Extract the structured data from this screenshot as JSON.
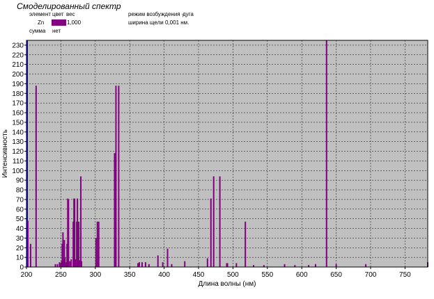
{
  "header": {
    "title": "Смоделированный спектр",
    "legend_header": {
      "element": "элемент",
      "color": "цвет",
      "weight": "вес"
    },
    "legend_row": {
      "element": "Zn",
      "weight": "1,000"
    },
    "sum": {
      "label": "сумма",
      "value": "нет"
    },
    "excitation": {
      "label": "режим возбуждения -",
      "value": "дуга"
    },
    "slit": {
      "label": "ширина щели",
      "value": "0,001 нм."
    }
  },
  "colors": {
    "plot_bg": "#c0c0c0",
    "series": "#800080",
    "left_line": "#0000ff"
  },
  "chart_data": {
    "type": "bar",
    "xlabel": "Длина волны (нм)",
    "ylabel": "Интенсивность",
    "xlim": [
      200,
      783
    ],
    "ylim": [
      0,
      235
    ],
    "xticks": [
      200,
      250,
      300,
      350,
      400,
      450,
      500,
      550,
      600,
      650,
      700,
      750
    ],
    "yticks": [
      0,
      10,
      20,
      30,
      40,
      50,
      60,
      70,
      80,
      90,
      100,
      110,
      120,
      130,
      140,
      150,
      160,
      170,
      180,
      190,
      200,
      210,
      220,
      230
    ],
    "grid": true,
    "series": [
      {
        "element": "Zn",
        "x": [
          202,
          206,
          214,
          242,
          245,
          248,
          250,
          251,
          252,
          253,
          254,
          255,
          256,
          258,
          259,
          260,
          261,
          263,
          265,
          268,
          269,
          270,
          271,
          273,
          274,
          275,
          276,
          277,
          279,
          280,
          301,
          303,
          305,
          328,
          330,
          334,
          362,
          364,
          368,
          373,
          378,
          391,
          398,
          405,
          411,
          430,
          463,
          468,
          472,
          481,
          491,
          492,
          505,
          518,
          530,
          545,
          575,
          590,
          610,
          620,
          636,
          650,
          693,
          783
        ],
        "values": [
          48,
          24,
          188,
          3,
          3,
          5,
          4,
          6,
          24,
          36,
          7,
          28,
          10,
          5,
          24,
          71,
          70,
          6,
          8,
          47,
          71,
          71,
          8,
          47,
          71,
          6,
          47,
          7,
          94,
          6,
          30,
          47,
          47,
          118,
          188,
          188,
          4,
          5,
          5,
          5,
          3,
          12,
          5,
          19,
          3,
          6,
          9,
          71,
          94,
          94,
          4,
          4,
          4,
          47,
          2,
          2,
          3,
          2,
          2,
          3,
          235,
          3,
          3,
          5
        ]
      }
    ]
  }
}
